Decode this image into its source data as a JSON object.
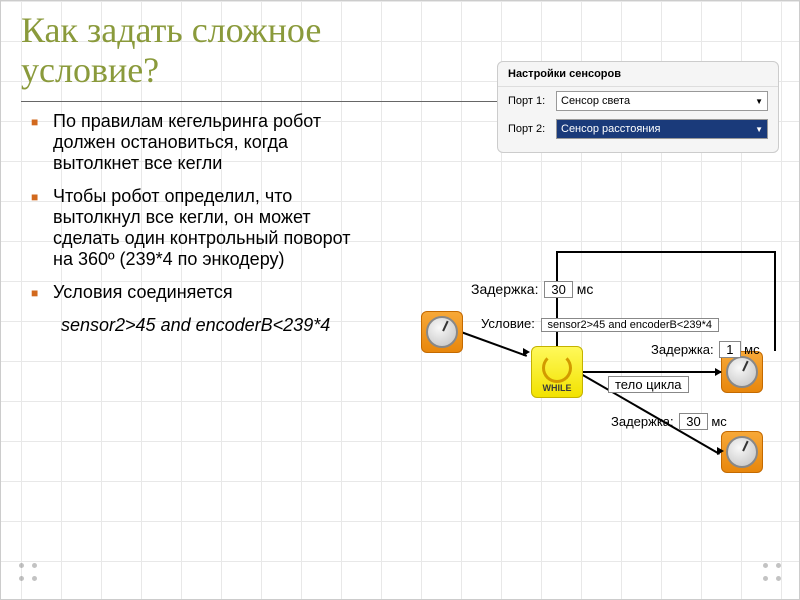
{
  "title_line1": "Как задать сложное",
  "title_line2": "условие?",
  "bullets": {
    "b1": "По правилам кегельринга робот должен остановиться, когда вытолкнет все кегли",
    "b2": "Чтобы робот определил, что вытолкнул все кегли, он может сделать один контрольный поворот на 360º (239*4 по энкодеру)",
    "b3": "Условия соединяется"
  },
  "cond_text": "sensor2>45 and encoderB<239*4",
  "sensor_panel": {
    "header": "Настройки сенсоров",
    "port1_label": "Порт 1:",
    "port1_value": "Сенсор света",
    "port2_label": "Порт 2:",
    "port2_value": "Сенсор расстояния"
  },
  "diagram": {
    "delay1_label": "Задержка:",
    "delay1_val": "30",
    "delay1_unit": "мс",
    "condition_label": "Условие:",
    "condition_val": "sensor2>45 and encoderB<239*4",
    "delay2_label": "Задержка:",
    "delay2_val": "1",
    "delay2_unit": "мс",
    "body_label": "тело цикла",
    "delay3_label": "Задержка:",
    "delay3_val": "30",
    "delay3_unit": "мс",
    "while_label": "WHILE"
  }
}
